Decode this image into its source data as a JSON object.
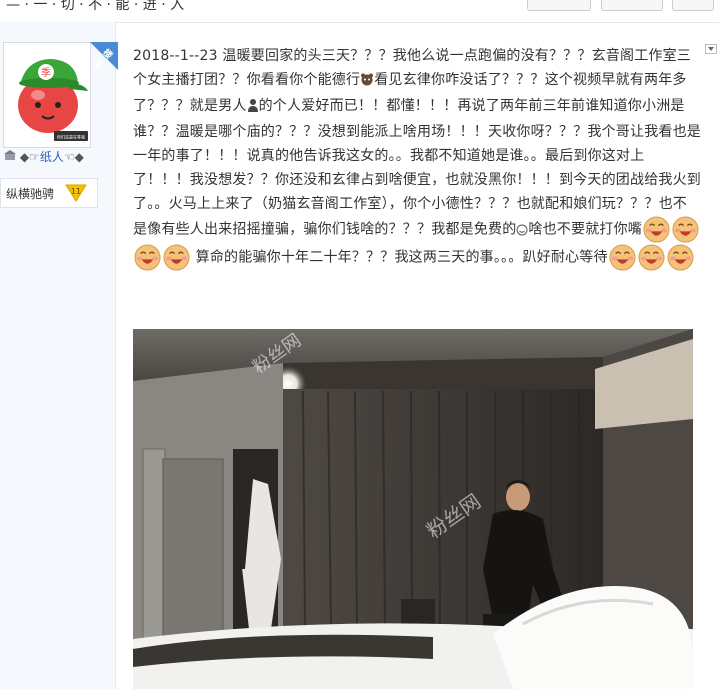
{
  "header": {
    "crumb": "— · 一 · 切 · 不 · 能 · 进 · 入"
  },
  "author": {
    "badge": "楼主",
    "avatar_text": "季",
    "avatar_caption": "你们这是在等我",
    "name": "纸人",
    "name_prefix": "◆☞",
    "name_suffix": "☜◆",
    "level_name": "纵横驰骋",
    "level_number": "11"
  },
  "post": {
    "paragraph_1": "2018--1--23 温暖要回家的头三天？？？我他么说一点跑偏的没有？？？玄音阁工作室三个女主播打团？？你看看你个能德行",
    "paragraph_1b": "看见玄律你咋没话了？？？这个视频早就有两年多了？？？就是男人",
    "paragraph_1c": "的个人爱好而已！！都懂！！！再说了两年前三年前谁知道你小洲是谁？？温暖是哪个庙的？？？没想到能派上啥用场！！！天收你呀？？？我个哥让我看也是一年的事了！！！说真的他告诉我这女的。。我都不知道她是谁。。最后到你这对上了！！！我没想发？？你还没和玄律占到啥便宜，也就没黑你！！！到今天的团战给我火到了。。火马上上来了（奶猫玄音阁工作室），你个小德性？？？也就配和娘们玩？？？也不是像有些人出来招摇撞骗，骗你们钱啥的？？？我都是免费的",
    "paragraph_1d": "啥也不要就打你嘴",
    "paragraph_2": "算命的能骗你十年二十年？？？我这两三天的事。。。趴好耐心等待"
  },
  "photo": {
    "watermark": "粉丝网"
  },
  "colors": {
    "link_blue": "#2d64b3",
    "badge_blue": "#4a8ad3",
    "emoji_face": "#f5c27a",
    "level_badge": "#f2c200"
  }
}
